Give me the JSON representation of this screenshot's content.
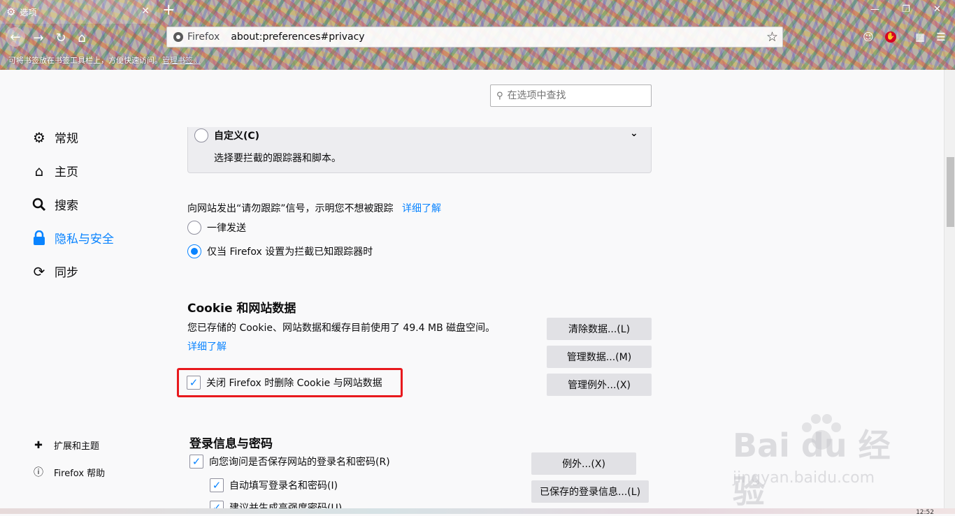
{
  "browser": {
    "tab_title": "选项",
    "identity": "Firefox",
    "url": "about:preferences#privacy",
    "bookmarks_hint": "可将书签放在书签工具栏上，方便快速访问。",
    "bookmarks_link": "管理书签..."
  },
  "search": {
    "placeholder": "在选项中查找"
  },
  "sidebar": {
    "items": [
      {
        "label": "常规",
        "icon": "gear-icon"
      },
      {
        "label": "主页",
        "icon": "home-icon"
      },
      {
        "label": "搜索",
        "icon": "search-icon"
      },
      {
        "label": "隐私与安全",
        "icon": "lock-icon",
        "active": true
      },
      {
        "label": "同步",
        "icon": "sync-icon"
      }
    ],
    "footer": [
      {
        "label": "扩展和主题",
        "icon": "puzzle-icon"
      },
      {
        "label": "Firefox 帮助",
        "icon": "help-icon"
      }
    ]
  },
  "custom": {
    "title": "自定义(C)",
    "description": "选择要拦截的跟踪器和脚本。"
  },
  "dnt": {
    "text": "向网站发出“请勿跟踪”信号，示明您不想被跟踪",
    "learn_more": "详细了解",
    "options": [
      {
        "label": "一律发送",
        "checked": false
      },
      {
        "label": "仅当 Firefox 设置为拦截已知跟踪器时",
        "checked": true
      }
    ]
  },
  "cookies": {
    "heading": "Cookie 和网站数据",
    "usage_text": "您已存储的 Cookie、网站数据和缓存目前使用了 49.4 MB 磁盘空间。",
    "learn_more": "详细了解",
    "delete_on_close": "关闭 Firefox 时删除 Cookie 与网站数据",
    "delete_on_close_checked": true,
    "buttons": {
      "clear": "清除数据...(L)",
      "manage": "管理数据...(M)",
      "exceptions": "管理例外...(X)"
    }
  },
  "logins": {
    "heading": "登录信息与密码",
    "ask_save": "向您询问是否保存网站的登录名和密码(R)",
    "autofill": "自动填写登录名和密码(I)",
    "suggest": "建议并生成高强度密码(U)",
    "buttons": {
      "exceptions": "例外...(X)",
      "saved": "已保存的登录信息...(L)"
    }
  },
  "watermark": {
    "brand": "Bai du 经验",
    "url": "jingyan.baidu.com"
  },
  "tray": {
    "clock": "12:52"
  },
  "colors": {
    "accent": "#0a84ff",
    "highlight": "#e8191d"
  }
}
